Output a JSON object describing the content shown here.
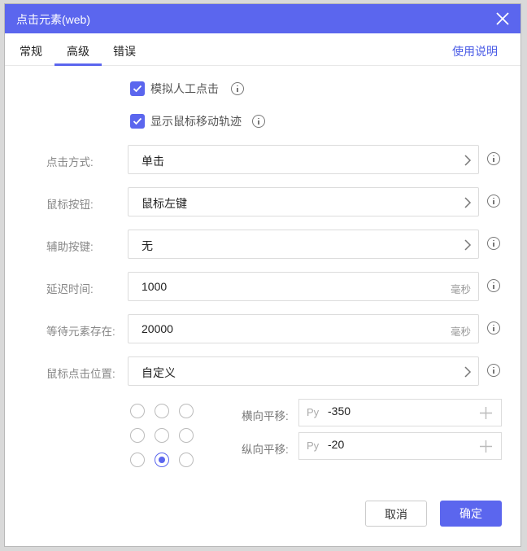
{
  "window": {
    "title": "点击元素(web)"
  },
  "tabs": [
    {
      "label": "常规"
    },
    {
      "label": "高级"
    },
    {
      "label": "错误"
    }
  ],
  "help_link": "使用说明",
  "checkboxes": [
    {
      "label": "模拟人工点击",
      "checked": true
    },
    {
      "label": "显示鼠标移动轨迹",
      "checked": true
    }
  ],
  "fields": {
    "click_mode": {
      "label": "点击方式:",
      "value": "单击"
    },
    "mouse_button": {
      "label": "鼠标按钮:",
      "value": "鼠标左键"
    },
    "modifier_key": {
      "label": "辅助按键:",
      "value": "无"
    },
    "delay": {
      "label": "延迟时间:",
      "value": "1000",
      "unit": "毫秒"
    },
    "wait_element": {
      "label": "等待元素存在:",
      "value": "20000",
      "unit": "毫秒"
    },
    "click_position": {
      "label": "鼠标点击位置:",
      "value": "自定义"
    }
  },
  "position_grid": {
    "selected_row": 2,
    "selected_col": 1
  },
  "offsets": {
    "horizontal": {
      "label": "横向平移:",
      "prefix": "Py",
      "value": "-350"
    },
    "vertical": {
      "label": "纵向平移:",
      "prefix": "Py",
      "value": "-20"
    }
  },
  "buttons": {
    "cancel": "取消",
    "ok": "确定"
  },
  "colors": {
    "accent": "#5b66ee",
    "link": "#4a5be6"
  }
}
